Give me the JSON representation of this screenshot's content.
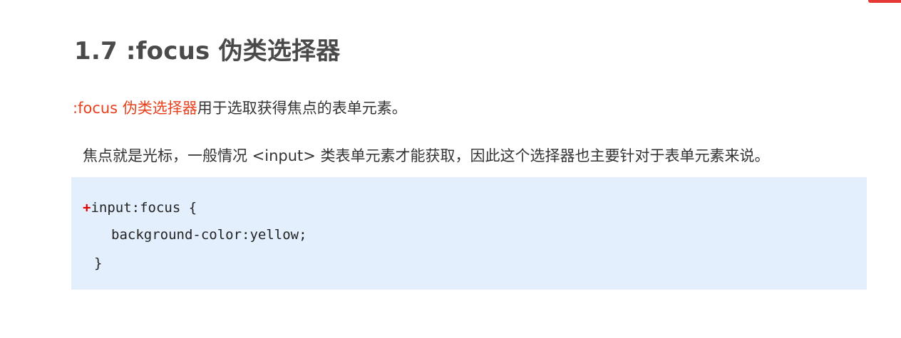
{
  "colors": {
    "highlight": "#e8401c",
    "code_background": "#e3effd",
    "plus_marker": "#e00000"
  },
  "heading": {
    "title": "1.7 :focus 伪类选择器"
  },
  "intro": {
    "highlight_text": ":focus 伪类选择器",
    "rest_text": "用于选取获得焦点的表单元素。"
  },
  "detail": {
    "text": "焦点就是光标，一般情况 <input> 类表单元素才能获取，因此这个选择器也主要针对于表单元素来说。"
  },
  "code": {
    "marker": "+",
    "line1": "input:focus {",
    "line2": "background-color:yellow;",
    "line3": "}"
  }
}
